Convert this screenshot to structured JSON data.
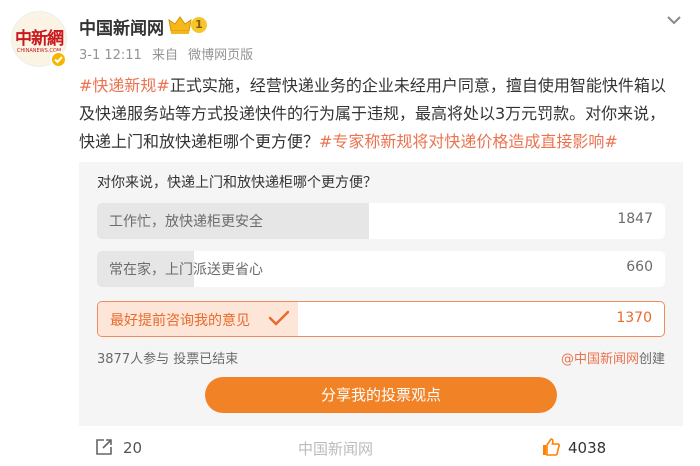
{
  "author": {
    "name": "中国新闻网",
    "avatar_logo_text": "中新網",
    "avatar_logo_subtext": "CHINANEWS.COM",
    "level_badge": "1",
    "timestamp": "3-1 12:11",
    "source_prefix": "来自",
    "source": "微博网页版"
  },
  "post": {
    "tag1": "#快递新规#",
    "text": "正式实施，经营快递业务的企业未经用户同意，擅自使用智能快件箱以及快递服务站等方式投递快件的行为属于违规，最高将处以3万元罚款。对你来说，快递上门和放快递柜哪个更方便？",
    "tag2": "#专家称新规将对快递价格造成直接影响#"
  },
  "poll": {
    "question": "对你来说，快递上门和放快递柜哪个更方便？",
    "options": [
      {
        "label": "工作忙，放快递柜更安全",
        "count": "1847",
        "share": 0.478
      },
      {
        "label": "常在家，上门派送更省心",
        "count": "660",
        "share": 0.171
      },
      {
        "label": "最好提前咨询我的意见",
        "count": "1370",
        "share": 0.354,
        "chosen": true
      }
    ],
    "stats": "3877人参与 投票已结束",
    "creator_handle": "@中国新闻网",
    "creator_suffix": "创建",
    "share_button": "分享我的投票观点"
  },
  "actions": {
    "repost_count": "20",
    "like_count": "4038",
    "watermark": "中国新闻网"
  },
  "colors": {
    "accent": "#eb7350",
    "button": "#f28226",
    "chosen_fill": "#fde6d7"
  }
}
